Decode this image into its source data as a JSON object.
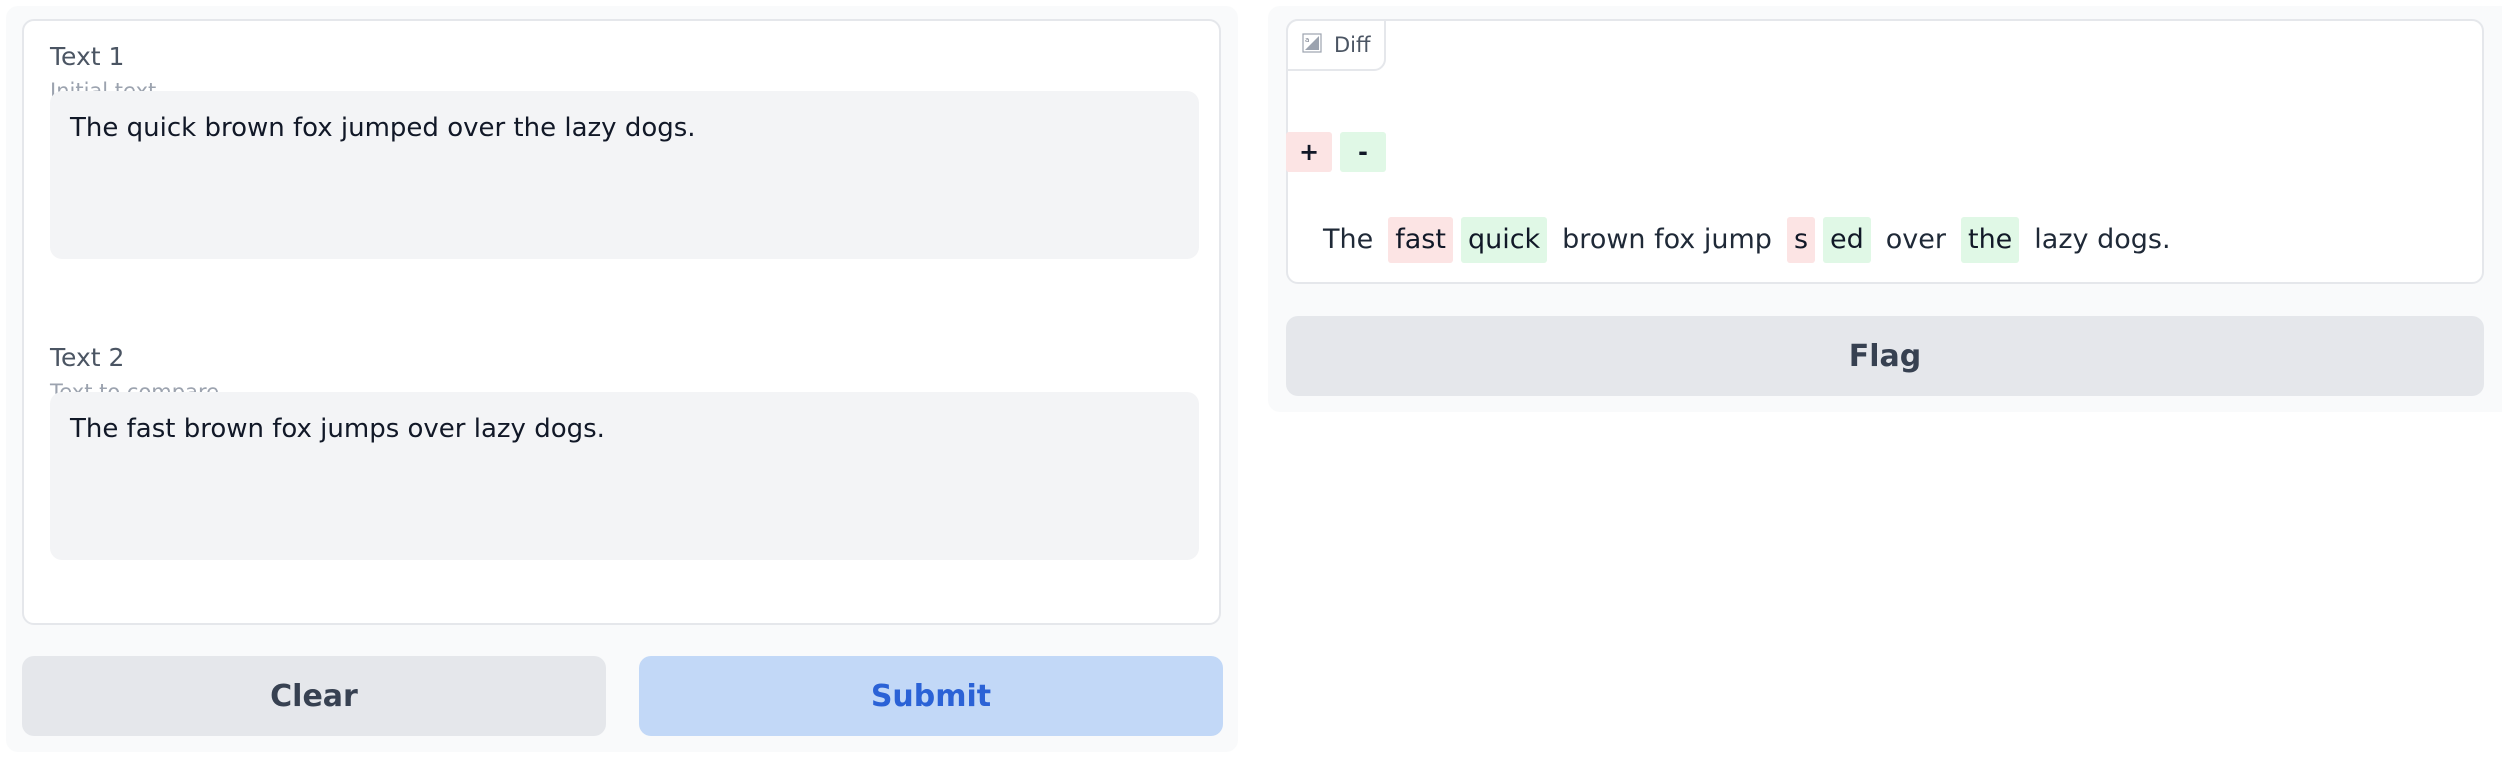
{
  "inputs": {
    "text1": {
      "label": "Text 1",
      "info": "Initial text",
      "value": "The quick brown fox jumped over the lazy dogs."
    },
    "text2": {
      "label": "Text 2",
      "info": "Text to compare",
      "value": "The fast brown fox jumps over lazy dogs."
    }
  },
  "buttons": {
    "clear": "Clear",
    "submit": "Submit",
    "flag": "Flag"
  },
  "diff": {
    "tab_label": "Diff",
    "legend": [
      {
        "symbol": "+",
        "kind": "added"
      },
      {
        "symbol": "-",
        "kind": "removed"
      }
    ],
    "tokens": [
      {
        "text": "The",
        "kind": "same"
      },
      {
        "text": "fast",
        "kind": "added"
      },
      {
        "text": "quick",
        "kind": "removed"
      },
      {
        "text": "brown fox jump",
        "kind": "same"
      },
      {
        "text": "s",
        "kind": "added"
      },
      {
        "text": "ed",
        "kind": "removed"
      },
      {
        "text": "over",
        "kind": "same"
      },
      {
        "text": "the",
        "kind": "removed"
      },
      {
        "text": "lazy dogs.",
        "kind": "same"
      }
    ]
  },
  "colors": {
    "added_bg": "#fce4e4",
    "removed_bg": "#e0f8e6",
    "submit_bg": "#c2d8f7",
    "submit_text": "#2b62d6"
  }
}
